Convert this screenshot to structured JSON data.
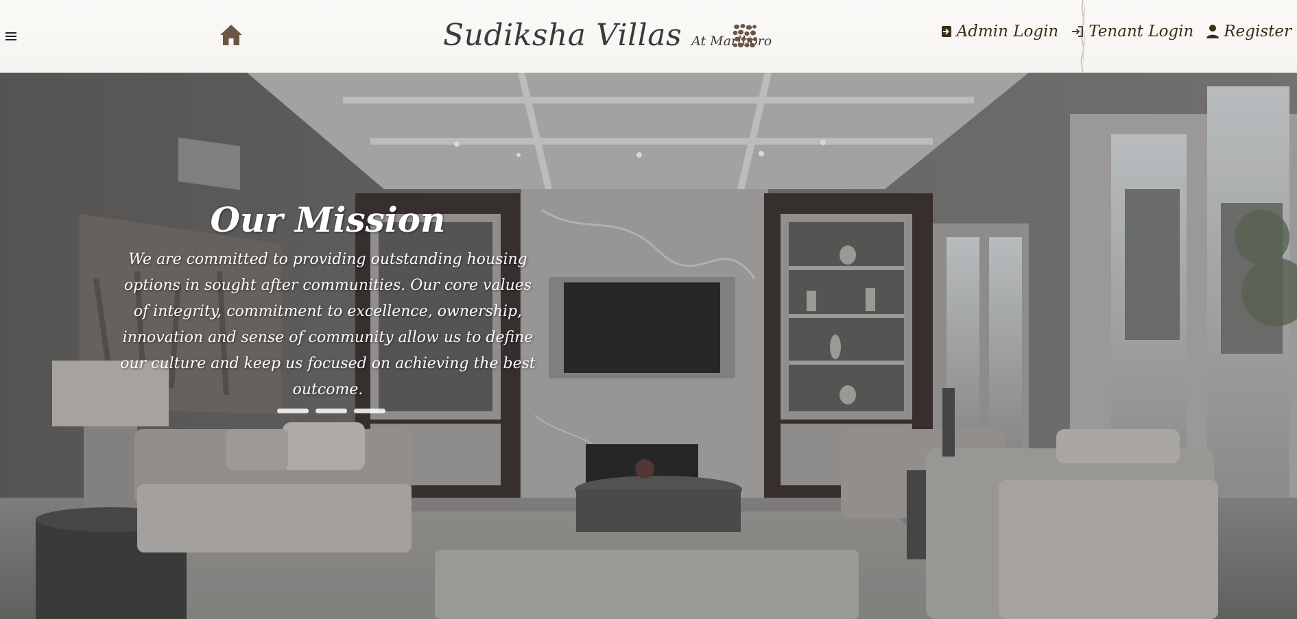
{
  "header": {
    "brand_title": "Sudiksha Villas",
    "brand_subtitle": "At Marlboro",
    "nav": {
      "admin_login": "Admin Login",
      "tenant_login": "Tenant Login",
      "register": "Register"
    },
    "icons": {
      "menu": "hamburger-menu-icon",
      "home": "home-icon",
      "logo": "pebbles-logo-icon",
      "admin": "sign-in-icon",
      "tenant": "login-arrow-icon",
      "register": "user-icon"
    }
  },
  "hero": {
    "carousel": {
      "title": "Our Mission",
      "text": "We are committed to providing outstanding housing options in sought after communities. Our core values of integrity, commitment to excellence, ownership, innovation and sense of community allow us to define our culture and keep us focused on achieving the best outcome.",
      "slide_count": 3
    }
  },
  "colors": {
    "header_bg": "#f7f5f2",
    "brand_text": "#3b3a39",
    "nav_text": "#3a2e18",
    "home_icon": "#6b5645",
    "hero_overlay": "#5c5a59",
    "mission_text": "#ffffff"
  }
}
